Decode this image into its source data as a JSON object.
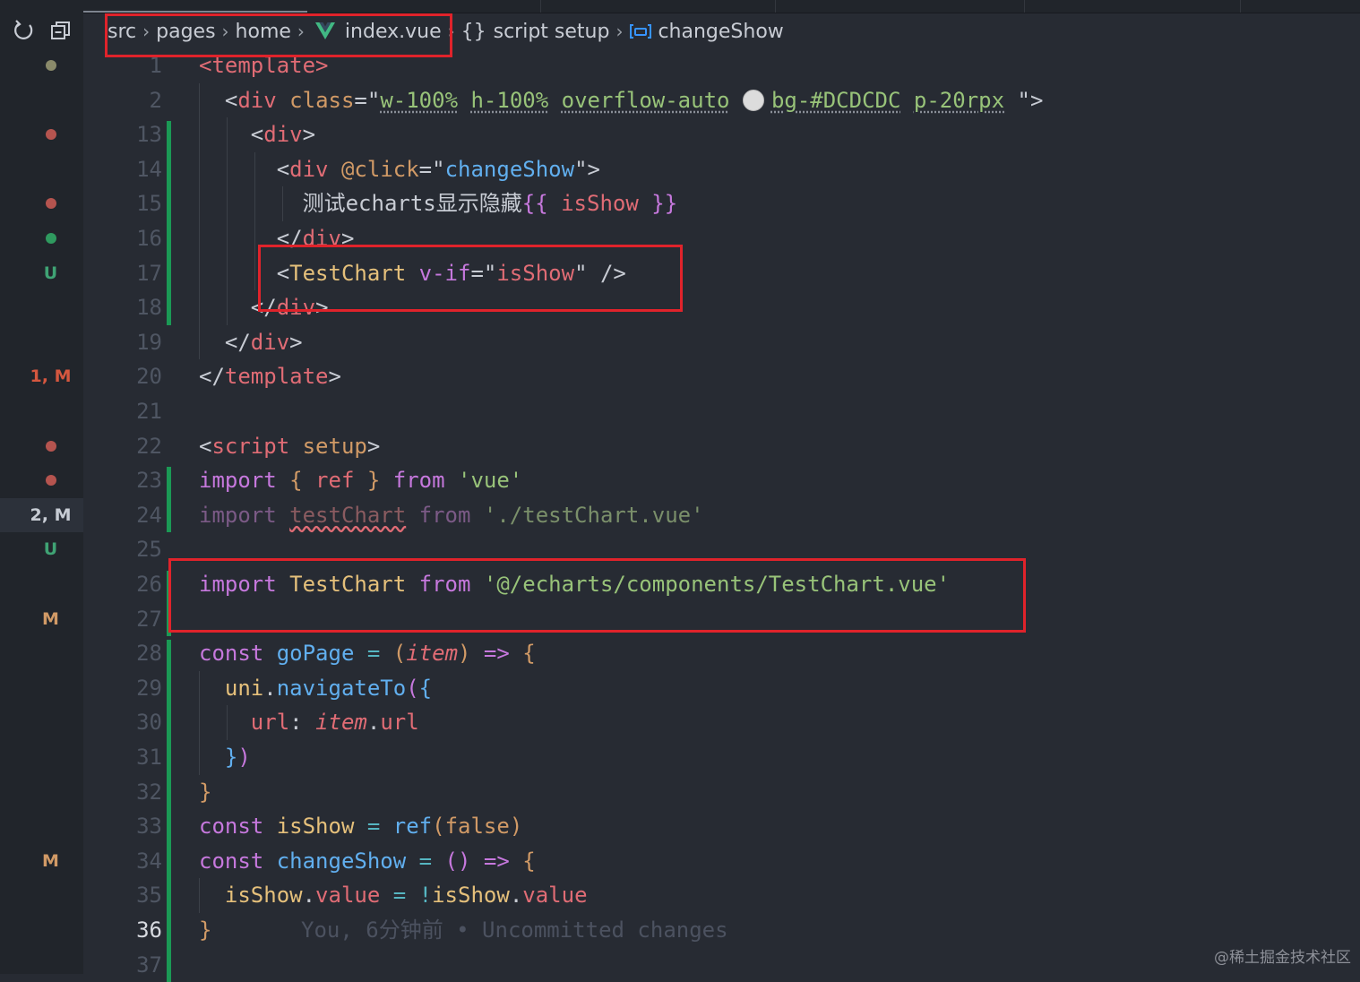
{
  "breadcrumb": {
    "items": [
      "src",
      "pages",
      "home",
      "index.vue",
      "script setup",
      "changeShow"
    ],
    "brace_glyph": "{}"
  },
  "scm": {
    "indicators": [
      {
        "line": 1,
        "kind": "dot",
        "color": "#8a8a6a"
      },
      {
        "line": 13,
        "kind": "dot",
        "color": "#b5544f"
      },
      {
        "line": 15,
        "kind": "dot",
        "color": "#b5544f"
      },
      {
        "line": 16,
        "kind": "dot",
        "color": "#2f9a5f"
      },
      {
        "line": 17,
        "kind": "text",
        "text": "U",
        "color": "#3fa374"
      },
      {
        "line": 20,
        "kind": "text",
        "text": "1, M",
        "color": "#d5573f"
      },
      {
        "line": 22,
        "kind": "dot",
        "color": "#b5544f"
      },
      {
        "line": 23,
        "kind": "dot",
        "color": "#b5544f"
      },
      {
        "line": 24,
        "kind": "text",
        "text": "2, M",
        "color": "#c7ccd4",
        "active": true
      },
      {
        "line": 25,
        "kind": "text",
        "text": "U",
        "color": "#3fa374"
      },
      {
        "line": 27,
        "kind": "text",
        "text": "M",
        "color": "#d19a66"
      },
      {
        "line": 34,
        "kind": "text",
        "text": "M",
        "color": "#d19a66"
      }
    ]
  },
  "editor": {
    "current_line": 36,
    "line_numbers": [
      1,
      2,
      13,
      14,
      15,
      16,
      17,
      18,
      19,
      20,
      21,
      22,
      23,
      24,
      25,
      26,
      27,
      28,
      29,
      30,
      31,
      32,
      33,
      34,
      35,
      36,
      37
    ],
    "lines": [
      [
        [
          "tag",
          "<template>"
        ]
      ],
      [
        [
          "punc",
          "  <"
        ],
        [
          "tag",
          "div"
        ],
        [
          "attr",
          " class"
        ],
        [
          "punc",
          "=\""
        ],
        [
          "str",
          "w-100%",
          1
        ],
        [
          "punc",
          " "
        ],
        [
          "str",
          "h-100%",
          1
        ],
        [
          "punc",
          " "
        ],
        [
          "str",
          "overflow-auto",
          1
        ],
        [
          "punc",
          " "
        ],
        [
          "swatch",
          ""
        ],
        [
          "str",
          "bg-#DCDCDC",
          1
        ],
        [
          "punc",
          " "
        ],
        [
          "str",
          "p-20rpx",
          1
        ],
        [
          "punc",
          " \">"
        ]
      ],
      [
        [
          "punc",
          "    <"
        ],
        [
          "tag",
          "div"
        ],
        [
          "punc",
          ">"
        ]
      ],
      [
        [
          "punc",
          "      <"
        ],
        [
          "tag",
          "div"
        ],
        [
          "attr",
          " @click"
        ],
        [
          "punc",
          "=\""
        ],
        [
          "fn",
          "changeShow"
        ],
        [
          "punc",
          "\">"
        ]
      ],
      [
        [
          "punc",
          "        测试echarts显示隐藏"
        ],
        [
          "kw",
          "{{"
        ],
        [
          "prop",
          " isShow "
        ],
        [
          "kw",
          "}}"
        ]
      ],
      [
        [
          "punc",
          "      </"
        ],
        [
          "tag",
          "div"
        ],
        [
          "punc",
          ">"
        ]
      ],
      [
        [
          "punc",
          "      <"
        ],
        [
          "var",
          "TestChart"
        ],
        [
          "kw",
          " v-if"
        ],
        [
          "punc",
          "=\""
        ],
        [
          "prop",
          "isShow"
        ],
        [
          "punc",
          "\" />"
        ]
      ],
      [
        [
          "punc",
          "    </"
        ],
        [
          "tag",
          "div"
        ],
        [
          "punc",
          ">"
        ]
      ],
      [
        [
          "punc",
          "  </"
        ],
        [
          "tag",
          "div"
        ],
        [
          "punc",
          ">"
        ]
      ],
      [
        [
          "punc",
          "</"
        ],
        [
          "tag",
          "template"
        ],
        [
          "punc",
          ">"
        ]
      ],
      [],
      [
        [
          "punc",
          "<"
        ],
        [
          "tag",
          "script"
        ],
        [
          "attr",
          " setup"
        ],
        [
          "punc",
          ">"
        ]
      ],
      [
        [
          "kw",
          "import"
        ],
        [
          "punc",
          " "
        ],
        [
          "attr",
          "{"
        ],
        [
          "prop",
          " ref "
        ],
        [
          "attr",
          "}"
        ],
        [
          "kw",
          " from"
        ],
        [
          "str",
          " 'vue'"
        ]
      ],
      [
        [
          "dim-kw",
          "import"
        ],
        [
          "punc",
          " "
        ],
        [
          "dim-var-squig",
          "testChart"
        ],
        [
          "dim-kw",
          " from"
        ],
        [
          "dim-str",
          " './testChart.vue'"
        ]
      ],
      [],
      [
        [
          "kw",
          "import"
        ],
        [
          "var",
          " TestChart"
        ],
        [
          "kw",
          " from"
        ],
        [
          "str",
          " '@/echarts/components/TestChart.vue'"
        ]
      ],
      [],
      [
        [
          "kw",
          "const"
        ],
        [
          "fn",
          " goPage"
        ],
        [
          "op",
          " ="
        ],
        [
          "attr",
          " ("
        ],
        [
          "prm",
          "item"
        ],
        [
          "attr",
          ")"
        ],
        [
          "kw",
          " =>"
        ],
        [
          "attr",
          " {"
        ]
      ],
      [
        [
          "var",
          "  uni"
        ],
        [
          "punc",
          "."
        ],
        [
          "fn",
          "navigateTo"
        ],
        [
          "kw",
          "("
        ],
        [
          "fn",
          "{"
        ]
      ],
      [
        [
          "prop",
          "    url"
        ],
        [
          "punc",
          ": "
        ],
        [
          "prm",
          "item"
        ],
        [
          "punc",
          "."
        ],
        [
          "prop",
          "url"
        ]
      ],
      [
        [
          "fn",
          "  }"
        ],
        [
          "kw",
          ")"
        ]
      ],
      [
        [
          "attr",
          "}"
        ]
      ],
      [
        [
          "kw",
          "const"
        ],
        [
          "var",
          " isShow"
        ],
        [
          "op",
          " ="
        ],
        [
          "fn",
          " ref"
        ],
        [
          "attr",
          "("
        ],
        [
          "attr",
          "false"
        ],
        [
          "attr",
          ")"
        ]
      ],
      [
        [
          "kw",
          "const"
        ],
        [
          "fn",
          " changeShow"
        ],
        [
          "op",
          " ="
        ],
        [
          "kw",
          " ()"
        ],
        [
          "kw",
          " =>"
        ],
        [
          "attr",
          " {"
        ]
      ],
      [
        [
          "var",
          "  isShow"
        ],
        [
          "punc",
          "."
        ],
        [
          "prop",
          "value"
        ],
        [
          "op",
          " ="
        ],
        [
          "op",
          " !"
        ],
        [
          "var",
          "isShow"
        ],
        [
          "punc",
          "."
        ],
        [
          "prop",
          "value"
        ]
      ],
      [
        [
          "attr",
          "}"
        ]
      ],
      []
    ],
    "ghost_text": "You, 6分钟前 • Uncommitted changes"
  },
  "watermark": "@稀土掘金技术社区"
}
